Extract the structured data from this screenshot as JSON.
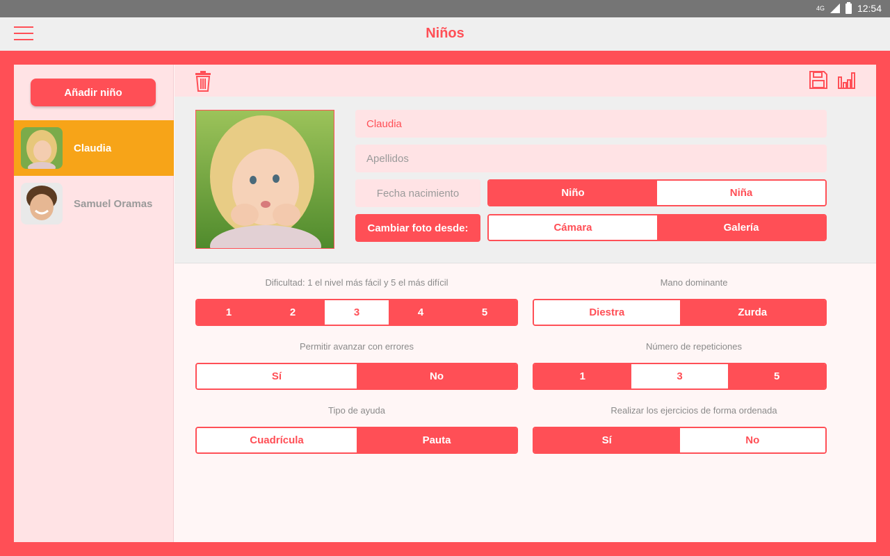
{
  "status": {
    "network": "4G",
    "time": "12:54"
  },
  "appbar": {
    "title": "Niños"
  },
  "sidebar": {
    "add_label": "Añadir niño",
    "children": [
      {
        "name": "Claudia",
        "selected": true
      },
      {
        "name": "Samuel Oramas",
        "selected": false
      }
    ]
  },
  "profile": {
    "first_name": "Claudia",
    "last_name_placeholder": "Apellidos",
    "birth_placeholder": "Fecha nacimiento",
    "gender_options": [
      "Niño",
      "Niña"
    ],
    "gender_selected": "Niño",
    "change_photo_label": "Cambiar foto desde:",
    "photo_source_options": [
      "Cámara",
      "Galería"
    ],
    "photo_source_selected": "Galería"
  },
  "settings": {
    "difficulty": {
      "label": "Dificultad: 1 el nivel más fácil y 5 el más difícil",
      "options": [
        "1",
        "2",
        "3",
        "4",
        "5"
      ],
      "selected": "3"
    },
    "hand": {
      "label": "Mano dominante",
      "options": [
        "Diestra",
        "Zurda"
      ],
      "selected": "Diestra"
    },
    "errors": {
      "label": "Permitir avanzar con errores",
      "options": [
        "Sí",
        "No"
      ],
      "selected": "Sí"
    },
    "repetitions": {
      "label": "Número de repeticiones",
      "options": [
        "1",
        "3",
        "5"
      ],
      "selected": "3"
    },
    "help": {
      "label": "Tipo de ayuda",
      "options": [
        "Cuadrícula",
        "Pauta"
      ],
      "selected": "Cuadrícula"
    },
    "ordered": {
      "label": "Realizar los ejercicios de forma ordenada",
      "options": [
        "Sí",
        "No"
      ],
      "selected": "No"
    }
  },
  "colors": {
    "accent": "#ff4f56",
    "selected_item": "#f7a418",
    "light_pink": "#ffe3e5"
  }
}
